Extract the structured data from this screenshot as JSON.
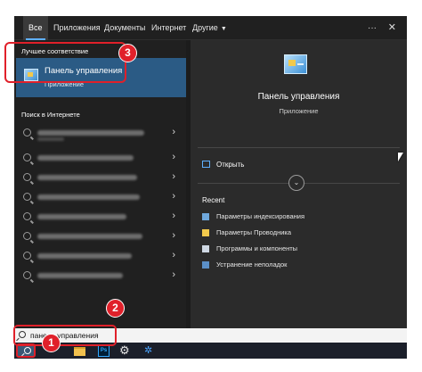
{
  "tabs": [
    {
      "label": "Все",
      "active": true
    },
    {
      "label": "Приложения",
      "active": false
    },
    {
      "label": "Документы",
      "active": false
    },
    {
      "label": "Интернет",
      "active": false
    },
    {
      "label": "Другие",
      "active": false
    }
  ],
  "window_controls": {
    "more": "···",
    "close": "✕"
  },
  "left": {
    "best_match_header": "Лучшее соответствие",
    "best_match": {
      "title": "Панель управления",
      "subtitle": "Приложение",
      "icon": "control-panel-icon"
    },
    "web_header": "Поиск в Интернете",
    "web_results_count": 8
  },
  "right": {
    "title": "Панель управления",
    "subtitle": "Приложение",
    "open_label": "Открыть",
    "recent_header": "Recent",
    "recent": [
      {
        "label": "Параметры индексирования",
        "icon": "indexing-icon"
      },
      {
        "label": "Параметры Проводника",
        "icon": "folder-options-icon"
      },
      {
        "label": "Программы и компоненты",
        "icon": "programs-icon"
      },
      {
        "label": "Устранение неполадок",
        "icon": "troubleshoot-icon"
      }
    ]
  },
  "search": {
    "value": "панель управления"
  },
  "badges": {
    "one": "1",
    "two": "2",
    "three": "3"
  },
  "colors": {
    "accent": "#2b5b85",
    "highlight": "#e0202a",
    "tab_underline": "#5fb0ff"
  }
}
